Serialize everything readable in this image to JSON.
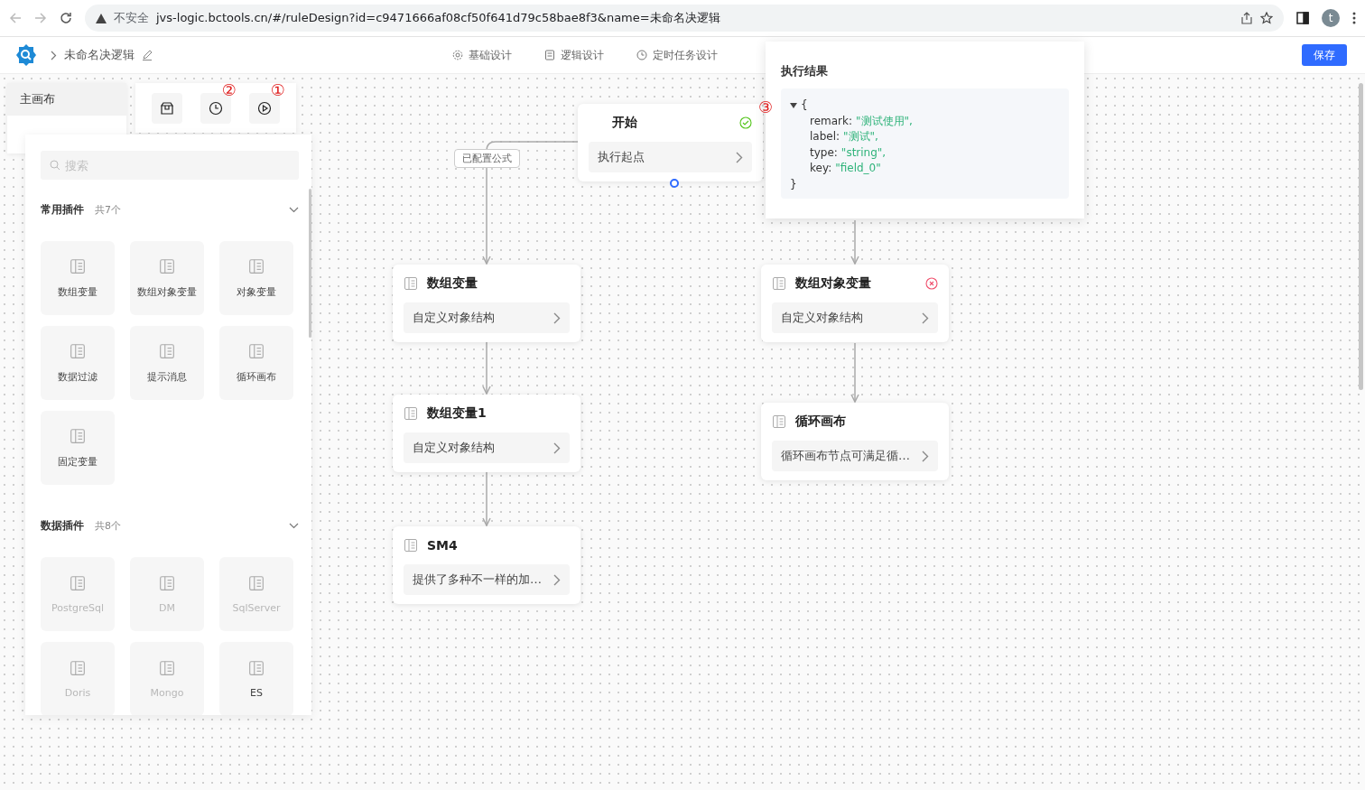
{
  "browser": {
    "security": "不安全",
    "url": "jvs-logic.bctools.cn/#/ruleDesign?id=c9471666af08cf50f641d79c58bae8f3&name=未命名决逻辑",
    "avatar": "t"
  },
  "header": {
    "title": "未命名决逻辑",
    "tabs": [
      {
        "label": "基础设计"
      },
      {
        "label": "逻辑设计"
      },
      {
        "label": "定时任务设计"
      }
    ],
    "save": "保存"
  },
  "canvas_tabs": [
    {
      "label": "主画布",
      "selected": true
    }
  ],
  "toolbar": {
    "markers": [
      "②",
      "①"
    ]
  },
  "plugin_panel": {
    "search": {
      "placeholder": "搜索"
    },
    "groups": [
      {
        "title": "常用插件",
        "count": "共7个",
        "items": [
          {
            "label": "数组变量",
            "disabled": false
          },
          {
            "label": "数组对象变量",
            "disabled": false
          },
          {
            "label": "对象变量",
            "disabled": false
          },
          {
            "label": "数据过滤",
            "disabled": false
          },
          {
            "label": "提示消息",
            "disabled": false
          },
          {
            "label": "循环画布",
            "disabled": false
          },
          {
            "label": "固定变量",
            "disabled": false
          }
        ]
      },
      {
        "title": "数据插件",
        "count": "共8个",
        "items": [
          {
            "label": "PostgreSql",
            "disabled": true
          },
          {
            "label": "DM",
            "disabled": true
          },
          {
            "label": "SqlServer",
            "disabled": true
          },
          {
            "label": "Doris",
            "disabled": true
          },
          {
            "label": "Mongo",
            "disabled": true
          },
          {
            "label": "ES",
            "disabled": false
          }
        ]
      }
    ]
  },
  "nodes": [
    {
      "kind": "start",
      "title": "开始",
      "subtitle": "执行起点",
      "succeeded": true,
      "failed": false
    },
    {
      "kind": "plugin",
      "title": "数组变量",
      "subtitle": "自定义对象结构",
      "succeeded": false,
      "failed": false
    },
    {
      "kind": "plugin",
      "title": "数组变量1",
      "subtitle": "自定义对象结构",
      "succeeded": false,
      "failed": false
    },
    {
      "kind": "plugin",
      "title": "SM4",
      "subtitle": "提供了多种不一样的加…",
      "succeeded": false,
      "failed": false
    },
    {
      "kind": "plugin",
      "title": "数组对象变量",
      "subtitle": "自定义对象结构",
      "succeeded": false,
      "failed": true
    },
    {
      "kind": "plugin",
      "title": "循环画布",
      "subtitle": "循环画布节点可满足循…",
      "succeeded": false,
      "failed": false
    }
  ],
  "edge_label": "已配置公式",
  "result_popup": {
    "title": "执行结果",
    "marker": "③",
    "open": "{",
    "close": "}",
    "fields": [
      {
        "key": "remark:",
        "value": "\"测试使用\","
      },
      {
        "key": "label:",
        "value": "\"测试\","
      },
      {
        "key": "type:",
        "value": "\"string\","
      },
      {
        "key": "key:",
        "value": "\"field_0\""
      }
    ]
  }
}
